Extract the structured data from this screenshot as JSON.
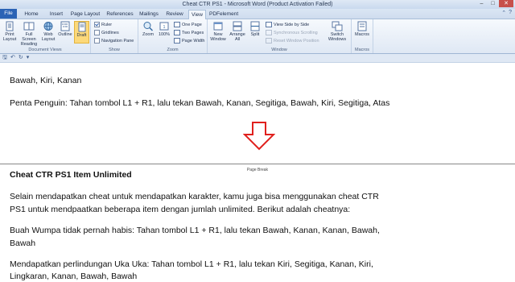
{
  "window": {
    "title": "Cheat CTR PS1 - Microsoft Word (Product Activation Failed)"
  },
  "tabs": [
    {
      "label": "File"
    },
    {
      "label": "Home"
    },
    {
      "label": "Insert"
    },
    {
      "label": "Page Layout"
    },
    {
      "label": "References"
    },
    {
      "label": "Mailings"
    },
    {
      "label": "Review"
    },
    {
      "label": "View"
    },
    {
      "label": "PDFelement"
    }
  ],
  "ribbon": {
    "document_views": {
      "label": "Document Views",
      "print_layout": "Print Layout",
      "full_screen_reading": "Full Screen Reading",
      "web_layout": "Web Layout",
      "outline": "Outline",
      "draft": "Draft"
    },
    "show": {
      "label": "Show",
      "ruler": "Ruler",
      "gridlines": "Gridlines",
      "navigation_pane": "Navigation Pane"
    },
    "zoom": {
      "label": "Zoom",
      "zoom": "Zoom",
      "percent": "100%",
      "one_page": "One Page",
      "two_pages": "Two Pages",
      "page_width": "Page Width"
    },
    "window": {
      "label": "Window",
      "new_window": "New Window",
      "arrange_all": "Arrange All",
      "split": "Split",
      "view_side_by_side": "View Side by Side",
      "synchronous_scrolling": "Synchronous Scrolling",
      "reset_window_position": "Reset Window Position",
      "switch_windows": "Switch Windows"
    },
    "macros": {
      "label": "Macros",
      "macros": "Macros"
    }
  },
  "document": {
    "line1": "Bawah, Kiri, Kanan",
    "line2": "Penta Penguin: Tahan tombol L1 + R1, lalu tekan Bawah, Kanan, Segitiga, Bawah, Kiri, Segitiga, Atas",
    "page_break": "Page Break",
    "heading": "Cheat CTR PS1 Item Unlimited",
    "para1_a": "Selain mendapatkan cheat untuk mendapatkan karakter, kamu juga bisa menggunakan cheat CTR",
    "para1_b": "PS1 untuk mendpaatkan beberapa item dengan jumlah unlimited. Berikut adalah cheatnya:",
    "para2_a": "Buah Wumpa tidak pernah habis: Tahan tombol L1 + R1, lalu tekan Bawah, Kanan, Kanan, Bawah,",
    "para2_b": "Bawah",
    "para3_a": "Mendapatkan perlindungan Uka Uka: Tahan tombol L1 + R1, lalu tekan Kiri, Segitiga, Kanan, Kiri,",
    "para3_b": "Lingkaran, Kanan, Bawah, Bawah"
  }
}
